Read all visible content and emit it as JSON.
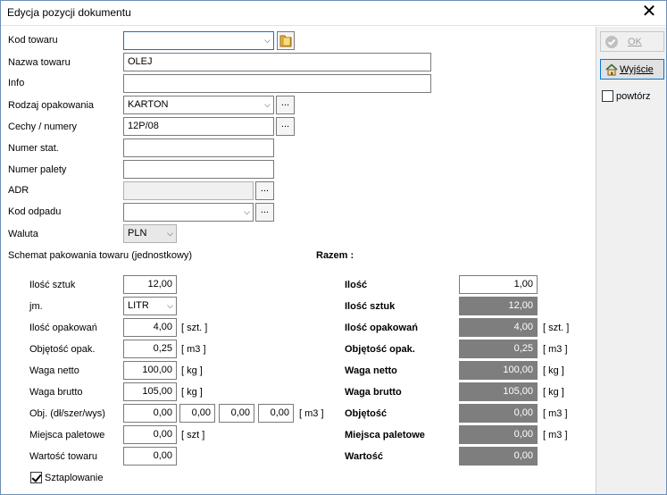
{
  "window": {
    "title": "Edycja pozycji dokumentu",
    "close_glyph": "✕"
  },
  "fields": {
    "kod_towaru": {
      "label": "Kod towaru",
      "value": ""
    },
    "nazwa_towaru": {
      "label": "Nazwa towaru",
      "value": "OLEJ"
    },
    "info": {
      "label": "Info",
      "value": ""
    },
    "rodzaj_opakowania": {
      "label": "Rodzaj opakowania",
      "value": "KARTON"
    },
    "cechy_numery": {
      "label": "Cechy / numery",
      "value": "12P/08"
    },
    "numer_stat": {
      "label": "Numer stat.",
      "value": ""
    },
    "numer_palety": {
      "label": "Numer palety",
      "value": ""
    },
    "adr": {
      "label": "ADR",
      "value": ""
    },
    "kod_odpadu": {
      "label": "Kod odpadu",
      "value": ""
    },
    "waluta": {
      "label": "Waluta",
      "value": "PLN"
    }
  },
  "ellipsis": "...",
  "schemat": {
    "heading": "Schemat pakowania towaru (jednostkowy)",
    "ilosc_sztuk": {
      "label": "Ilość sztuk",
      "value": "12,00"
    },
    "jm": {
      "label": "jm.",
      "value": "LITR"
    },
    "ilosc_opakowan": {
      "label": "Ilość opakowań",
      "value": "4,00",
      "unit": "[ szt. ]"
    },
    "objetosc_opak": {
      "label": "Objętość opak.",
      "value": "0,25",
      "unit": "[ m3 ]"
    },
    "waga_netto": {
      "label": "Waga netto",
      "value": "100,00",
      "unit": "[ kg ]"
    },
    "waga_brutto": {
      "label": "Waga brutto",
      "value": "105,00",
      "unit": "[ kg ]"
    },
    "obj": {
      "label": "Obj. (dł/szer/wys)",
      "v1": "0,00",
      "v2": "0,00",
      "v3": "0,00",
      "v4": "0,00",
      "unit": "[ m3 ]"
    },
    "miejsca_paletowe": {
      "label": "Miejsca paletowe",
      "value": "0,00",
      "unit": "[ szt ]"
    },
    "wartosc_towaru": {
      "label": "Wartość towaru",
      "value": "0,00"
    },
    "sztaplowanie": {
      "label": "Sztaplowanie",
      "checked": true
    }
  },
  "razem": {
    "heading": "Razem :",
    "ilosc": {
      "label": "Ilość",
      "value": "1,00"
    },
    "ilosc_sztuk": {
      "label": "Ilość sztuk",
      "value": "12,00"
    },
    "ilosc_opakowan": {
      "label": "Ilość opakowań",
      "value": "4,00",
      "unit": "[ szt. ]"
    },
    "objetosc_opak": {
      "label": "Objętość opak.",
      "value": "0,25",
      "unit": "[ m3 ]"
    },
    "waga_netto": {
      "label": "Waga netto",
      "value": "100,00",
      "unit": "[ kg ]"
    },
    "waga_brutto": {
      "label": "Waga brutto",
      "value": "105,00",
      "unit": "[ kg ]"
    },
    "objetosc": {
      "label": "Objętość",
      "value": "0,00",
      "unit": "[ m3 ]"
    },
    "miejsca_paletowe": {
      "label": "Miejsca paletowe",
      "value": "0,00",
      "unit": "[ m3 ]"
    },
    "wartosc": {
      "label": "Wartość",
      "value": "0,00"
    }
  },
  "side": {
    "ok_label": "OK",
    "wyjscie_label": "Wyjście",
    "powtorz_label": "powtórz"
  },
  "icons": {
    "ok": "check-circle-icon",
    "exit": "home-icon",
    "folder": "folder-icon"
  },
  "colors": {
    "accent": "#0078d7",
    "readonly_bg": "#7e7e7e"
  }
}
